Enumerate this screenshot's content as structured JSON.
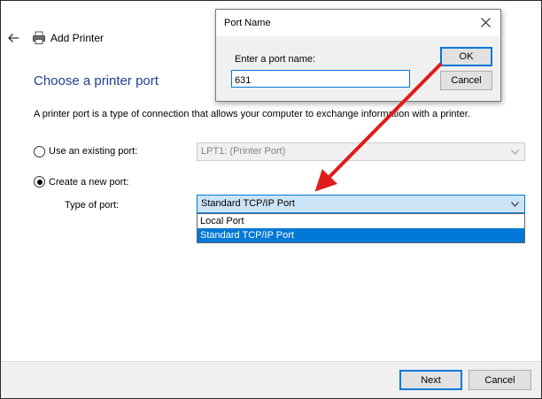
{
  "wizard": {
    "title": "Add Printer",
    "heading": "Choose a printer port",
    "description": "A printer port is a type of connection that allows your computer to exchange information with a printer."
  },
  "options": {
    "existing_label": "Use an existing port:",
    "existing_value": "LPT1: (Printer Port)",
    "existing_checked": false,
    "new_label": "Create a new port:",
    "new_checked": true,
    "type_label": "Type of port:",
    "type_value": "Standard TCP/IP Port",
    "type_options": [
      "Local Port",
      "Standard TCP/IP Port"
    ],
    "type_highlighted": "Standard TCP/IP Port"
  },
  "footer": {
    "next_label": "Next",
    "cancel_label": "Cancel"
  },
  "dialog": {
    "title": "Port Name",
    "prompt": "Enter a port name:",
    "port_value": "631",
    "ok_label": "OK",
    "cancel_label": "Cancel"
  },
  "colors": {
    "heading": "#1a3f8f",
    "selection": "#0078d7",
    "annotation_arrow": "#e01b1b"
  },
  "icons": {
    "back": "back-arrow-icon",
    "printer": "printer-icon",
    "close": "close-icon",
    "dropdown": "chevron-down-icon"
  }
}
